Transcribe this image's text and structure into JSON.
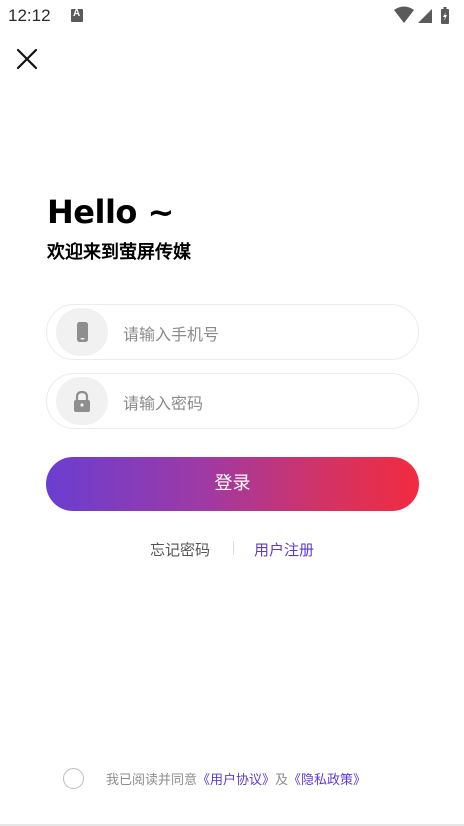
{
  "status_bar": {
    "time": "12:12"
  },
  "header": {
    "greeting": "Hello ~",
    "welcome": "欢迎来到萤屏传媒"
  },
  "form": {
    "phone_placeholder": "请输入手机号",
    "password_placeholder": "请输入密码",
    "login_label": "登录"
  },
  "links": {
    "forgot_password": "忘记密码",
    "register": "用户注册"
  },
  "agreement": {
    "prefix": "我已阅读并同意",
    "user_agreement": "《用户协议》",
    "conjunction": "及",
    "privacy_policy": "《隐私政策》"
  },
  "colors": {
    "accent": "#5b3ad6",
    "gradient_start": "#6a3ed1",
    "gradient_end": "#f22b40"
  },
  "icons": [
    "close-icon",
    "phone-icon",
    "lock-icon",
    "wifi-icon",
    "signal-icon",
    "battery-icon"
  ]
}
